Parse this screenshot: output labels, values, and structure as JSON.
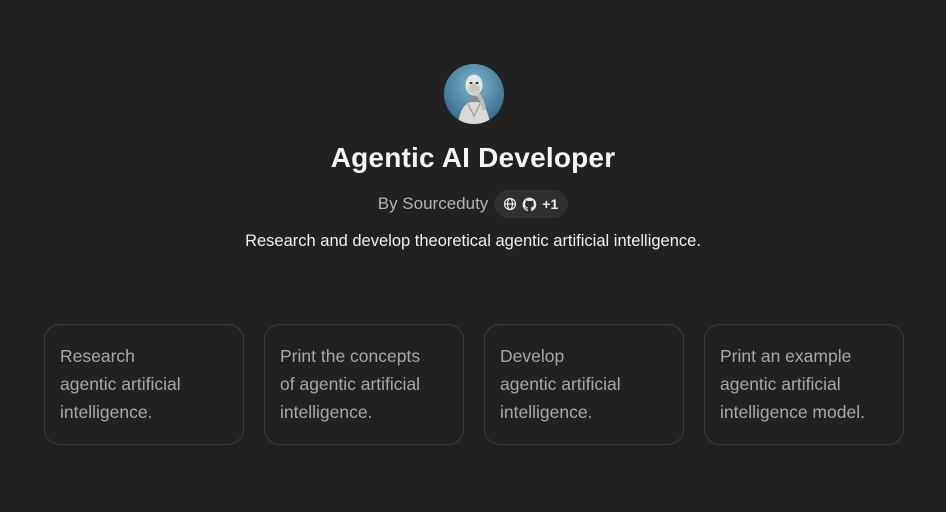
{
  "gpt": {
    "avatar_icon": "robot-thinking-avatar",
    "name": "Agentic AI Developer",
    "byline": "By Sourceduty",
    "links": {
      "icons": [
        "globe-icon",
        "github-icon"
      ],
      "more": "+1"
    },
    "description": "Research and develop theoretical agentic artificial intelligence."
  },
  "starters": [
    {
      "text": "Research\nagentic artificial\nintelligence."
    },
    {
      "text": "Print the concepts\nof agentic artificial\nintelligence."
    },
    {
      "text": "Develop\nagentic artificial\nintelligence."
    },
    {
      "text": "Print an example\nagentic artificial\nintelligence model."
    }
  ],
  "colors": {
    "background": "#212121",
    "card_border": "#3d3d3d",
    "pill_background": "#2f2f2f"
  }
}
